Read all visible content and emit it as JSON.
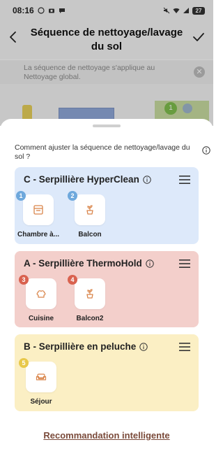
{
  "status_bar": {
    "time": "08:16",
    "battery": "27"
  },
  "header": {
    "title": "Séquence de nettoyage/lavage du sol"
  },
  "banner": {
    "text": "La séquence de nettoyage s'applique au Nettoyage global."
  },
  "map": {
    "pin_number": "1"
  },
  "sheet": {
    "question": "Comment ajuster la séquence de nettoyage/lavage du sol ?",
    "groups": [
      {
        "title": "C - Serpillière HyperClean",
        "color": "#dde9fa",
        "badge_color": "#6ea8dc",
        "rooms": [
          {
            "order": "1",
            "label": "Chambre à...",
            "icon": "bedroom-icon"
          },
          {
            "order": "2",
            "label": "Balcon",
            "icon": "plant-icon"
          }
        ]
      },
      {
        "title": "A - Serpillière ThermoHold",
        "color": "#f3cfcb",
        "badge_color": "#d9624f",
        "rooms": [
          {
            "order": "3",
            "label": "Cuisine",
            "icon": "chef-hat-icon"
          },
          {
            "order": "4",
            "label": "Balcon2",
            "icon": "plant-icon"
          }
        ]
      },
      {
        "title": "B - Serpillière en peluche",
        "color": "#fbefc4",
        "badge_color": "#e8c84a",
        "rooms": [
          {
            "order": "5",
            "label": "Séjour",
            "icon": "sofa-icon"
          }
        ]
      }
    ],
    "recommend_label": "Recommandation intelligente"
  }
}
